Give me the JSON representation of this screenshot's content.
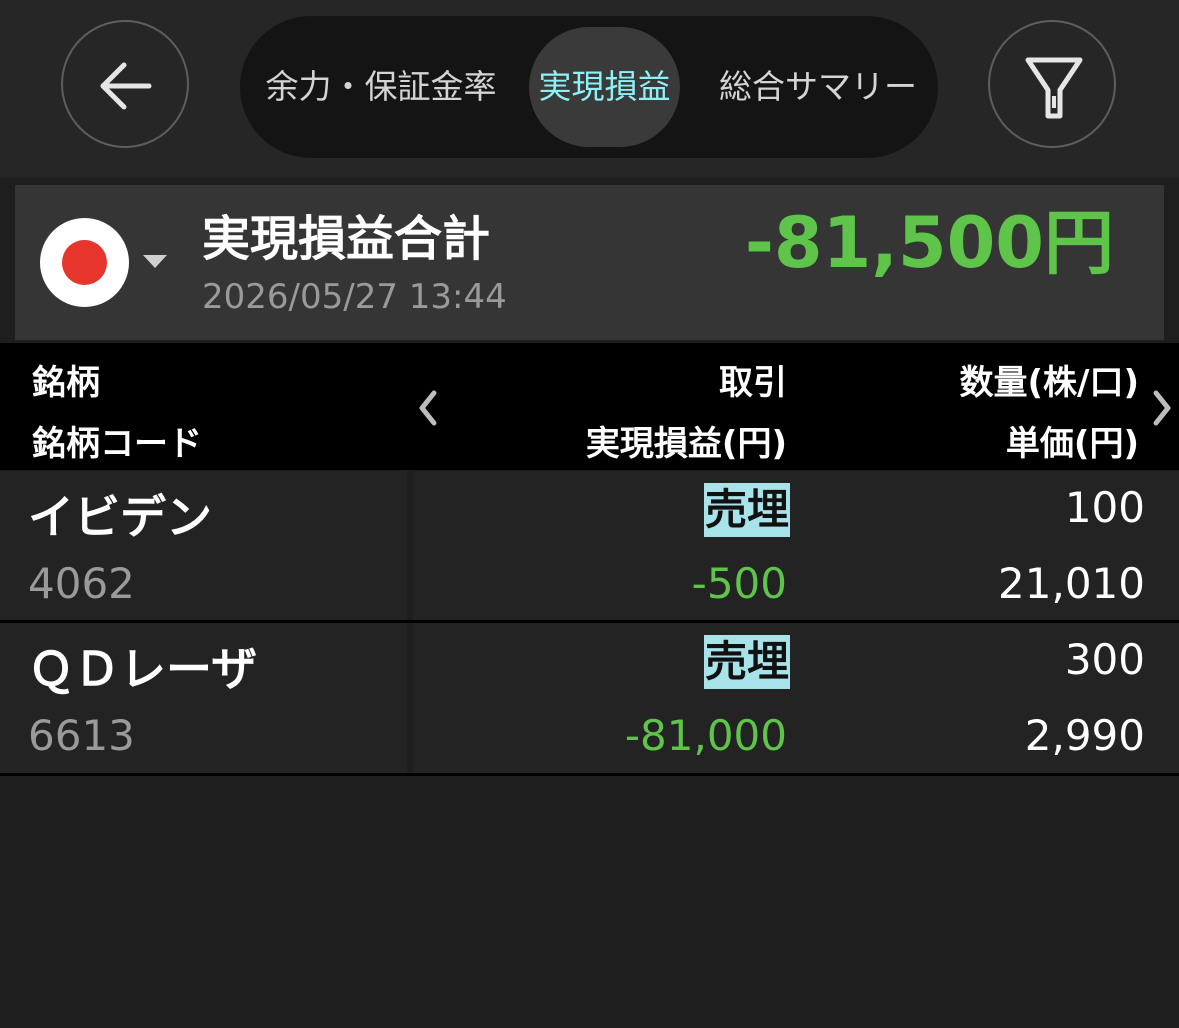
{
  "header": {
    "back_icon": "arrow-left-icon",
    "filter_icon": "filter-icon",
    "tabs": [
      {
        "label": "余力・保証金率",
        "active": false
      },
      {
        "label": "実現損益",
        "active": true
      },
      {
        "label": "総合サマリー",
        "active": false
      }
    ]
  },
  "summary": {
    "flag": "japan-flag-icon",
    "title": "実現損益合計",
    "timestamp": "2026/05/27 13:44",
    "total": "-81,500円"
  },
  "columns": {
    "col1_line1": "銘柄",
    "col1_line2": "銘柄コード",
    "col2_line1": "取引",
    "col2_line2": "実現損益(円)",
    "col3_line1": "数量(株/口)",
    "col3_line2": "単価(円)"
  },
  "rows": [
    {
      "name": "イビデン",
      "code": "4062",
      "trade": "売埋",
      "pnl": "-500",
      "qty": "100",
      "price": "21,010"
    },
    {
      "name": "ＱＤレーザ",
      "code": "6613",
      "trade": "売埋",
      "pnl": "-81,000",
      "qty": "300",
      "price": "2,990"
    }
  ],
  "colors": {
    "accent_tab": "#8ff0f5",
    "loss_green": "#5ec44a",
    "trade_badge_bg": "#a8e3ea",
    "flag_red": "#e8352c"
  }
}
